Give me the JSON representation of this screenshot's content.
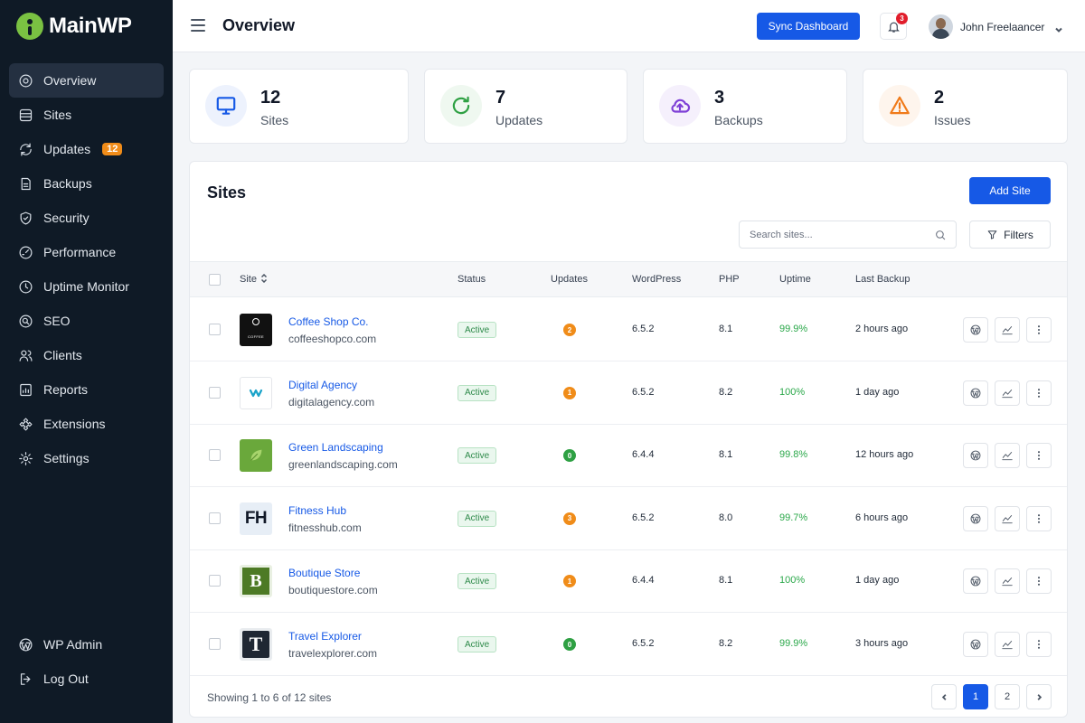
{
  "brand": {
    "name": "MainWP",
    "color": "#7ac142"
  },
  "sidebar": {
    "items": [
      {
        "label": "Overview",
        "icon": "overview-icon",
        "active": true
      },
      {
        "label": "Sites",
        "icon": "sites-icon"
      },
      {
        "label": "Updates",
        "icon": "refresh-icon",
        "badge": "12"
      },
      {
        "label": "Backups",
        "icon": "backup-icon"
      },
      {
        "label": "Security",
        "icon": "shield-icon"
      },
      {
        "label": "Performance",
        "icon": "gauge-icon"
      },
      {
        "label": "Uptime Monitor",
        "icon": "clock-icon"
      },
      {
        "label": "SEO",
        "icon": "seo-icon"
      },
      {
        "label": "Clients",
        "icon": "users-icon"
      },
      {
        "label": "Reports",
        "icon": "report-icon"
      },
      {
        "label": "Extensions",
        "icon": "puzzle-icon"
      },
      {
        "label": "Settings",
        "icon": "gear-icon"
      }
    ],
    "bottom": [
      {
        "label": "WP Admin",
        "icon": "wordpress-icon"
      },
      {
        "label": "Log Out",
        "icon": "logout-icon"
      }
    ]
  },
  "header": {
    "title": "Overview",
    "sync_label": "Sync Dashboard",
    "notification_count": "3",
    "user_name": "John Freelaancer"
  },
  "stats": [
    {
      "value": "12",
      "label": "Sites",
      "icon": "monitor-icon",
      "color": "#1659e6"
    },
    {
      "value": "7",
      "label": "Updates",
      "icon": "refresh-icon",
      "color": "#2ea043"
    },
    {
      "value": "3",
      "label": "Backups",
      "icon": "cloud-upload-icon",
      "color": "#7e3fd6"
    },
    {
      "value": "2",
      "label": "Issues",
      "icon": "warning-icon",
      "color": "#f07a19"
    }
  ],
  "sites_panel": {
    "title": "Sites",
    "add_label": "Add Site",
    "search_placeholder": "Search sites...",
    "filters_label": "Filters",
    "columns": {
      "site": "Site",
      "status": "Status",
      "updates": "Updates",
      "wordpress": "WordPress",
      "php": "PHP",
      "uptime": "Uptime",
      "last_backup": "Last Backup"
    },
    "rows": [
      {
        "name": "Coffee Shop Co.",
        "domain": "coffeeshopco.com",
        "status": "Active",
        "updates": "2",
        "wordpress": "6.5.2",
        "php": "8.1",
        "uptime": "99.9%",
        "last_backup": "2 hours ago",
        "logo": "coffee",
        "logo_text": "COFFEE"
      },
      {
        "name": "Digital Agency",
        "domain": "digitalagency.com",
        "status": "Active",
        "updates": "1",
        "wordpress": "6.5.2",
        "php": "8.2",
        "uptime": "100%",
        "last_backup": "1 day ago",
        "logo": "digital",
        "logo_text": ""
      },
      {
        "name": "Green Landscaping",
        "domain": "greenlandscaping.com",
        "status": "Active",
        "updates": "0",
        "wordpress": "6.4.4",
        "php": "8.1",
        "uptime": "99.8%",
        "last_backup": "12 hours ago",
        "logo": "green",
        "logo_text": ""
      },
      {
        "name": "Fitness Hub",
        "domain": "fitnesshub.com",
        "status": "Active",
        "updates": "3",
        "wordpress": "6.5.2",
        "php": "8.0",
        "uptime": "99.7%",
        "last_backup": "6 hours ago",
        "logo": "fitness",
        "logo_text": "FH"
      },
      {
        "name": "Boutique Store",
        "domain": "boutiquestore.com",
        "status": "Active",
        "updates": "1",
        "wordpress": "6.4.4",
        "php": "8.1",
        "uptime": "100%",
        "last_backup": "1 day ago",
        "logo": "boutique",
        "logo_text": "B"
      },
      {
        "name": "Travel Explorer",
        "domain": "travelexplorer.com",
        "status": "Active",
        "updates": "0",
        "wordpress": "6.5.2",
        "php": "8.2",
        "uptime": "99.9%",
        "last_backup": "3 hours ago",
        "logo": "travel",
        "logo_text": "T"
      }
    ],
    "footer_text": "Showing 1 to 6 of 12 sites",
    "pages": [
      "1",
      "2"
    ],
    "current_page": "1"
  },
  "colors": {
    "accent": "#1659e6",
    "sidebar_bg": "#0f1a26",
    "updates_nonzero": "#f08c19",
    "updates_zero": "#2ea043",
    "uptime": "#2ba84a"
  }
}
